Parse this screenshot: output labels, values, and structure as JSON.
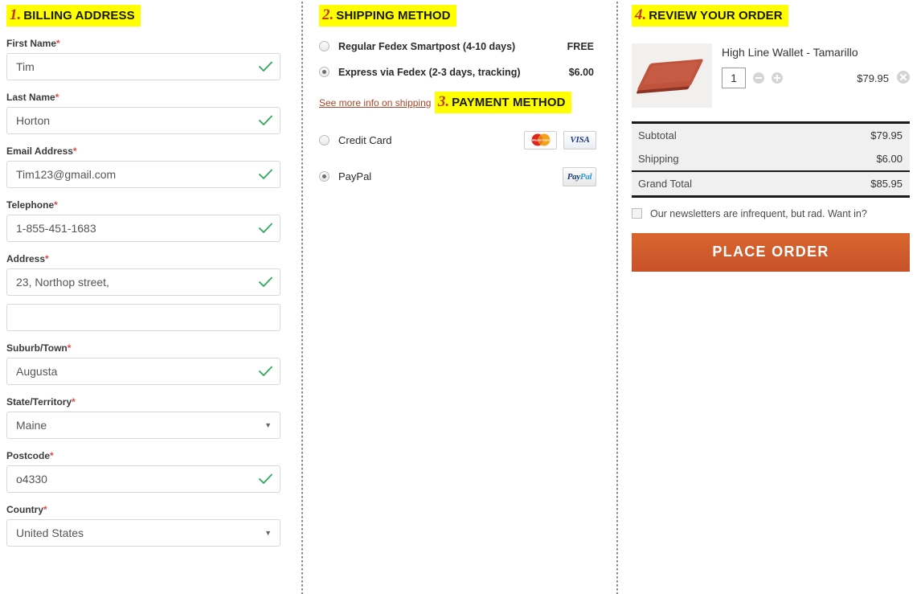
{
  "billing": {
    "step_number": "1.",
    "title": "BILLING ADDRESS",
    "fields": [
      {
        "label": "First Name",
        "required": "*",
        "value": "Tim",
        "type": "text",
        "valid": true
      },
      {
        "label": "Last Name",
        "required": "*",
        "value": "Horton",
        "type": "text",
        "valid": true
      },
      {
        "label": "Email Address",
        "required": "*",
        "value": "Tim123@gmail.com",
        "type": "text",
        "valid": true
      },
      {
        "label": "Telephone",
        "required": "*",
        "value": "1-855-451-1683",
        "type": "text",
        "valid": true
      },
      {
        "label": "Address",
        "required": "*",
        "value": "23, Northop street,",
        "type": "text",
        "valid": true
      },
      {
        "label": "",
        "required": "",
        "value": "",
        "type": "text",
        "valid": false
      },
      {
        "label": "Suburb/Town",
        "required": "*",
        "value": "Augusta",
        "type": "text",
        "valid": true
      },
      {
        "label": "State/Territory",
        "required": "*",
        "value": "Maine",
        "type": "select",
        "valid": false
      },
      {
        "label": "Postcode",
        "required": "*",
        "value": "o4330",
        "type": "text",
        "valid": true
      },
      {
        "label": "Country",
        "required": "*",
        "value": "United States",
        "type": "select",
        "valid": false
      }
    ]
  },
  "shipping": {
    "step_number": "2.",
    "title": "SHIPPING METHOD",
    "options": [
      {
        "label": "Regular Fedex Smartpost (4-10 days)",
        "price": "FREE",
        "selected": false
      },
      {
        "label": "Express via Fedex (2-3 days, tracking)",
        "price": "$6.00",
        "selected": true
      }
    ],
    "more_info_link": "See more info on shipping"
  },
  "payment": {
    "step_number": "3.",
    "title": "PAYMENT METHOD",
    "options": [
      {
        "label": "Credit Card",
        "selected": false,
        "badges": [
          "mastercard",
          "visa"
        ]
      },
      {
        "label": "PayPal",
        "selected": true,
        "badges": [
          "paypal"
        ]
      }
    ],
    "badge_text": {
      "visa": "VISA",
      "paypal_a": "Pay",
      "paypal_b": "Pal",
      "mastercard": "MasterCard"
    }
  },
  "review": {
    "step_number": "4.",
    "title": "REVIEW YOUR ORDER",
    "product": {
      "name": "High Line Wallet - Tamarillo",
      "quantity": "1",
      "price": "$79.95"
    },
    "totals": [
      {
        "label": "Subtotal",
        "value": "$79.95"
      },
      {
        "label": "Shipping",
        "value": "$6.00"
      },
      {
        "label": "Grand Total",
        "value": "$85.95"
      }
    ],
    "newsletter_text": "Our newsletters are infrequent, but rad. Want in?",
    "newsletter_checked": false,
    "place_order_label": "PLACE ORDER"
  },
  "colors": {
    "highlight": "#ffff00",
    "step_number": "#c0392b",
    "accent_button": "#d9662e",
    "valid_check": "#2eab5a",
    "required_star": "#e04a4a",
    "link": "#a8472a"
  }
}
